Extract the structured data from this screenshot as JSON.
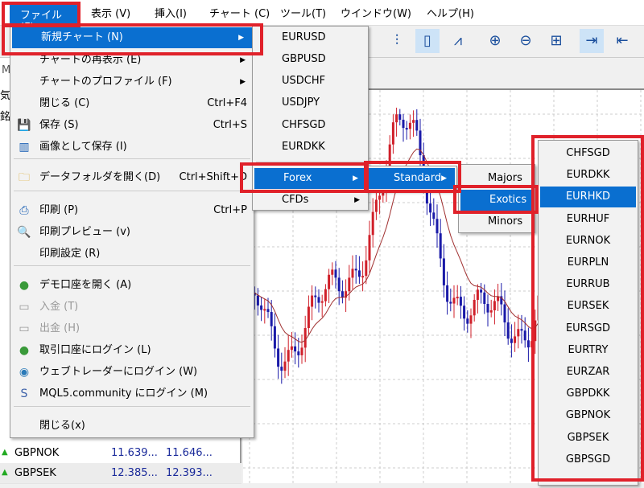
{
  "menubar": {
    "items": [
      "ファイル (F)",
      "表示 (V)",
      "挿入(I)",
      "チャート (C)",
      "ツール(T)",
      "ウインドウ(W)",
      "ヘルプ(H)"
    ]
  },
  "toolbar": {
    "icons": [
      "bar-chart-icon",
      "candlestick-icon",
      "line-chart-icon",
      "zoom-in-icon",
      "zoom-out-icon",
      "tile-windows-icon",
      "auto-scroll-icon",
      "chart-shift-icon"
    ]
  },
  "market_watch": {
    "header_fragments": [
      "M",
      "気配",
      "銘"
    ],
    "rows": [
      {
        "symbol": "GBPNOK",
        "bid": "11.639...",
        "ask": "11.646..."
      },
      {
        "symbol": "GBPSEK",
        "bid": "12.385...",
        "ask": "12.393..."
      }
    ]
  },
  "file_menu": {
    "items": [
      {
        "label": "新規チャート (N)",
        "shortcut": "",
        "submenu": true,
        "icon": ""
      },
      {
        "label": "チャートの再表示 (E)",
        "shortcut": "",
        "submenu": true,
        "icon": ""
      },
      {
        "label": "チャートのプロファイル (F)",
        "shortcut": "",
        "submenu": true,
        "icon": ""
      },
      {
        "label": "閉じる (C)",
        "shortcut": "Ctrl+F4",
        "icon": ""
      },
      {
        "label": "保存 (S)",
        "shortcut": "Ctrl+S",
        "icon": "save-icon"
      },
      {
        "label": "画像として保存 (I)",
        "shortcut": "",
        "icon": "save-image-icon"
      },
      {
        "label": "データフォルダを開く(D)",
        "shortcut": "Ctrl+Shift+D",
        "icon": "folder-icon"
      },
      {
        "label": "印刷 (P)",
        "shortcut": "Ctrl+P",
        "icon": "printer-icon"
      },
      {
        "label": "印刷プレビュー (v)",
        "shortcut": "",
        "icon": "print-preview-icon"
      },
      {
        "label": "印刷設定 (R)",
        "shortcut": "",
        "icon": ""
      },
      {
        "label": "デモ口座を開く (A)",
        "shortcut": "",
        "icon": "open-demo-account-icon"
      },
      {
        "label": "入金 (T)",
        "shortcut": "",
        "icon": "deposit-icon",
        "disabled": true
      },
      {
        "label": "出金 (H)",
        "shortcut": "",
        "icon": "withdraw-icon",
        "disabled": true
      },
      {
        "label": "取引口座にログイン (L)",
        "shortcut": "",
        "icon": "login-account-icon"
      },
      {
        "label": "ウェブトレーダーにログイン (W)",
        "shortcut": "",
        "icon": "webtrader-icon"
      },
      {
        "label": "MQL5.community にログイン (M)",
        "shortcut": "",
        "icon": "mql5-icon"
      },
      {
        "label": "閉じる(x)",
        "shortcut": "",
        "icon": ""
      }
    ]
  },
  "new_chart_submenu": {
    "items": [
      "EURUSD",
      "GBPUSD",
      "USDCHF",
      "USDJPY",
      "CHFSGD",
      "EURDKK"
    ],
    "groups": [
      "Forex",
      "CFDs"
    ]
  },
  "forex_submenu": {
    "items": [
      "Standard"
    ]
  },
  "standard_submenu": {
    "items": [
      "Majors",
      "Exotics",
      "Minors"
    ]
  },
  "exotics_submenu": {
    "items": [
      "CHFSGD",
      "EURDKK",
      "EURHKD",
      "EURHUF",
      "EURNOK",
      "EURPLN",
      "EURRUB",
      "EURSEK",
      "EURSGD",
      "EURTRY",
      "EURZAR",
      "GBPDKK",
      "GBPNOK",
      "GBPSEK",
      "GBPSGD"
    ],
    "selected": "EURHKD"
  },
  "colors": {
    "highlight": "#0a6fd0",
    "annotation": "#e0212a",
    "bull": "#d0202a",
    "bear": "#1a1aa8"
  }
}
